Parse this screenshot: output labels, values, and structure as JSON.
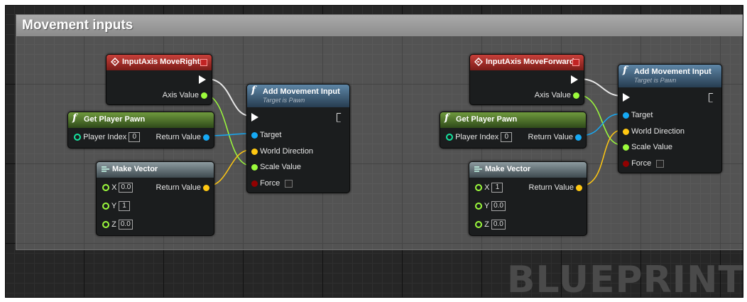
{
  "comment": {
    "title": "Movement inputs"
  },
  "watermark": "BLUEPRINT",
  "left": {
    "input_node": {
      "title": "InputAxis MoveRight",
      "axis_value_label": "Axis Value"
    },
    "get_pawn": {
      "title": "Get Player Pawn",
      "player_index_label": "Player Index",
      "player_index_value": "0",
      "return_label": "Return Value"
    },
    "make_vector": {
      "title": "Make Vector",
      "x_label": "X",
      "x_value": "0.0",
      "y_label": "Y",
      "y_value": "1",
      "z_label": "Z",
      "z_value": "0.0",
      "return_label": "Return Value"
    },
    "add_movement": {
      "title": "Add Movement Input",
      "subtitle": "Target is Pawn",
      "target_label": "Target",
      "world_direction_label": "World Direction",
      "scale_value_label": "Scale Value",
      "force_label": "Force"
    }
  },
  "right": {
    "input_node": {
      "title": "InputAxis MoveForward",
      "axis_value_label": "Axis Value"
    },
    "get_pawn": {
      "title": "Get Player Pawn",
      "player_index_label": "Player Index",
      "player_index_value": "0",
      "return_label": "Return Value"
    },
    "make_vector": {
      "title": "Make Vector",
      "x_label": "X",
      "x_value": "1",
      "y_label": "Y",
      "y_value": "0.0",
      "z_label": "Z",
      "z_value": "0.0",
      "return_label": "Return Value"
    },
    "add_movement": {
      "title": "Add Movement Input",
      "subtitle": "Target is Pawn",
      "target_label": "Target",
      "world_direction_label": "World Direction",
      "scale_value_label": "Scale Value",
      "force_label": "Force"
    }
  },
  "colors": {
    "float_pin": "#9cfb3c",
    "object_pin": "#16a9f4",
    "vector_pin": "#ffc812",
    "exec_pin": "#ffffff",
    "bool_pin": "#920101",
    "wire_exec": "#e8e8e8"
  },
  "icons": {
    "input_event": "diamond-arrow-icon",
    "function": "function-f-icon",
    "make_vector": "make-vector-icon"
  }
}
